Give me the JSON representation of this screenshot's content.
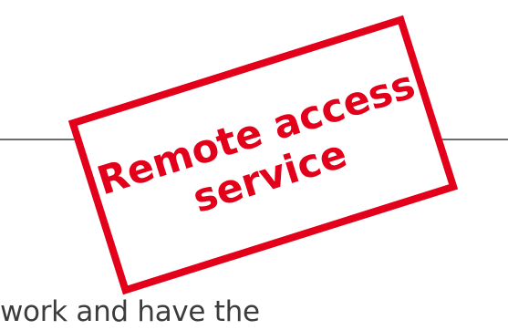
{
  "stamp": {
    "line1": "Remote access",
    "line2": "service",
    "color": "#e3001b"
  },
  "body": {
    "partial_text": "work and have the"
  },
  "colors": {
    "divider": "#6e6e6e",
    "text": "#3c3c3c",
    "background": "#ffffff"
  }
}
